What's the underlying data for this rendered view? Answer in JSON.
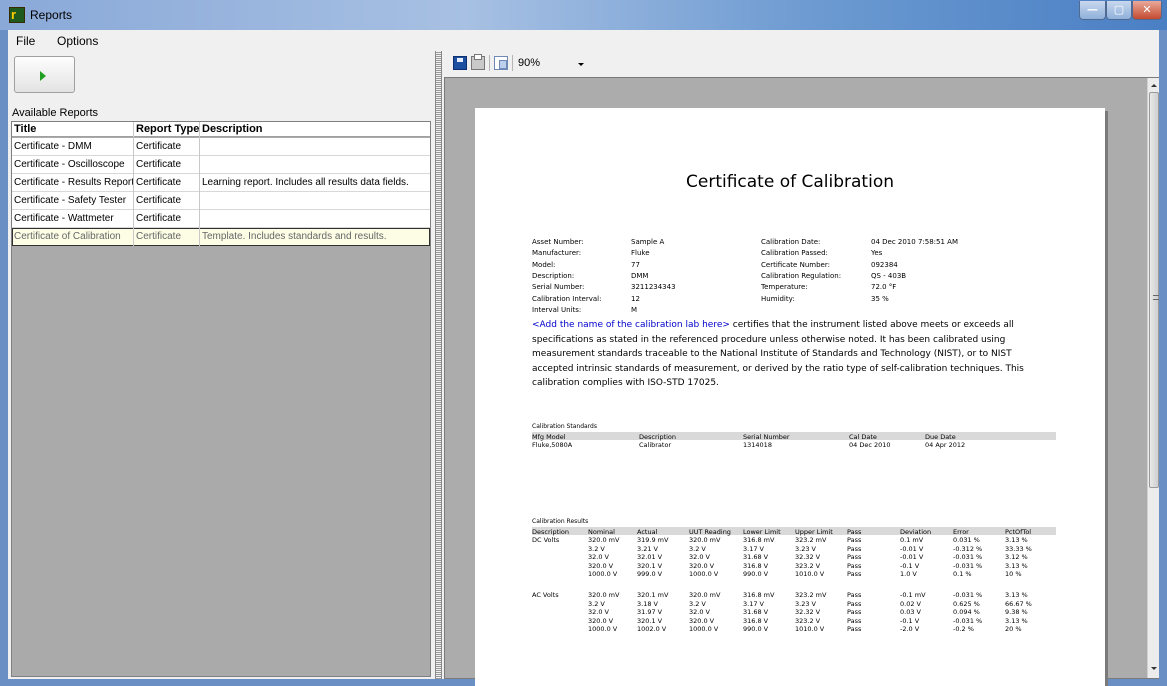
{
  "window": {
    "title": "Reports",
    "icon": "reports-app-icon",
    "min": "—",
    "max": "▢",
    "close": "✕"
  },
  "menu": {
    "file": "File",
    "options": "Options"
  },
  "left": {
    "run_icon": "play-icon",
    "available_label": "Available Reports",
    "columns": [
      "Title",
      "Report Type",
      "Description"
    ],
    "rows": [
      {
        "title": "Certificate - DMM",
        "type": "Certificate",
        "description": ""
      },
      {
        "title": "Certificate - Oscilloscope",
        "type": "Certificate",
        "description": ""
      },
      {
        "title": "Certificate - Results Report",
        "type": "Certificate",
        "description": "Learning report. Includes all results data fields."
      },
      {
        "title": "Certificate - Safety Tester",
        "type": "Certificate",
        "description": ""
      },
      {
        "title": "Certificate - Wattmeter",
        "type": "Certificate",
        "description": ""
      },
      {
        "title": "Certificate of Calibration",
        "type": "Certificate",
        "description": "Template. Includes standards and results."
      }
    ],
    "selected_index": 5
  },
  "toolbar": {
    "zoom": "90%",
    "icons": [
      "save-icon",
      "print-icon",
      "copy-icon"
    ]
  },
  "report": {
    "title": "Certificate of Calibration",
    "fields_left": [
      {
        "label": "Asset Number:",
        "value": "Sample A"
      },
      {
        "label": "Manufacturer:",
        "value": "Fluke"
      },
      {
        "label": "Model:",
        "value": "77"
      },
      {
        "label": "Description:",
        "value": "DMM"
      },
      {
        "label": "Serial Number:",
        "value": "3211234343"
      },
      {
        "label": "Calibration Interval:",
        "value": "12"
      },
      {
        "label": "Interval Units:",
        "value": "M"
      }
    ],
    "fields_right": [
      {
        "label": "Calibration Date:",
        "value": "04 Dec 2010 7:58:51 AM"
      },
      {
        "label": "Calibration Passed:",
        "value": "Yes"
      },
      {
        "label": "Certificate Number:",
        "value": "092384"
      },
      {
        "label": "Calibration Regulation:",
        "value": "QS - 403B"
      },
      {
        "label": "Temperature:",
        "value": "72.0 °F"
      },
      {
        "label": "Humidity:",
        "value": "35 %"
      }
    ],
    "lab_placeholder": "<Add the name of the calibration lab here>",
    "statement": " certifies that the instrument listed above meets or exceeds all specifications as stated in the referenced procedure unless otherwise noted. It has been calibrated using measurement standards traceable to the National Institute of Standards and Technology (NIST), or to NIST accepted intrinsic standards of measurement, or derived by the ratio type of self-calibration techniques. This calibration complies with ISO-STD 17025.",
    "standards_title": "Calibration Standards",
    "standards_columns": [
      "Mfg Model",
      "Description",
      "Serial Number",
      "Cal Date",
      "Due Date"
    ],
    "standards_rows": [
      [
        "Fluke,5080A",
        "Calibrator",
        "1314018",
        "04 Dec 2010",
        "04 Apr 2012"
      ]
    ],
    "results_title": "Calibration Results",
    "results_columns": [
      "Description",
      "Nominal",
      "Actual",
      "UUT Reading",
      "Lower Limit",
      "Upper Limit",
      "Pass",
      "Deviation",
      "Error",
      "PctOfTol"
    ],
    "results_groups": [
      {
        "description": "DC Volts",
        "rows": [
          [
            "320.0 mV",
            "319.9 mV",
            "320.0 mV",
            "316.8 mV",
            "323.2 mV",
            "Pass",
            "0.1 mV",
            "0.031 %",
            "3.13 %"
          ],
          [
            "3.2 V",
            "3.21 V",
            "3.2 V",
            "3.17 V",
            "3.23 V",
            "Pass",
            "-0.01 V",
            "-0.312 %",
            "33.33 %"
          ],
          [
            "32.0 V",
            "32.01 V",
            "32.0 V",
            "31.68 V",
            "32.32 V",
            "Pass",
            "-0.01 V",
            "-0.031 %",
            "3.12 %"
          ],
          [
            "320.0 V",
            "320.1 V",
            "320.0 V",
            "316.8 V",
            "323.2 V",
            "Pass",
            "-0.1 V",
            "-0.031 %",
            "3.13 %"
          ],
          [
            "1000.0 V",
            "999.0 V",
            "1000.0 V",
            "990.0 V",
            "1010.0 V",
            "Pass",
            "1.0 V",
            "0.1 %",
            "10 %"
          ]
        ]
      },
      {
        "description": "AC Volts",
        "rows": [
          [
            "320.0 mV",
            "320.1 mV",
            "320.0 mV",
            "316.8 mV",
            "323.2 mV",
            "Pass",
            "-0.1 mV",
            "-0.031 %",
            "3.13 %"
          ],
          [
            "3.2 V",
            "3.18 V",
            "3.2 V",
            "3.17 V",
            "3.23 V",
            "Pass",
            "0.02 V",
            "0.625 %",
            "66.67 %"
          ],
          [
            "32.0 V",
            "31.97 V",
            "32.0 V",
            "31.68 V",
            "32.32 V",
            "Pass",
            "0.03 V",
            "0.094 %",
            "9.38 %"
          ],
          [
            "320.0 V",
            "320.1 V",
            "320.0 V",
            "316.8 V",
            "323.2 V",
            "Pass",
            "-0.1 V",
            "-0.031 %",
            "3.13 %"
          ],
          [
            "1000.0 V",
            "1002.0 V",
            "1000.0 V",
            "990.0 V",
            "1010.0 V",
            "Pass",
            "-2.0 V",
            "-0.2 %",
            "20 %"
          ]
        ]
      }
    ]
  }
}
